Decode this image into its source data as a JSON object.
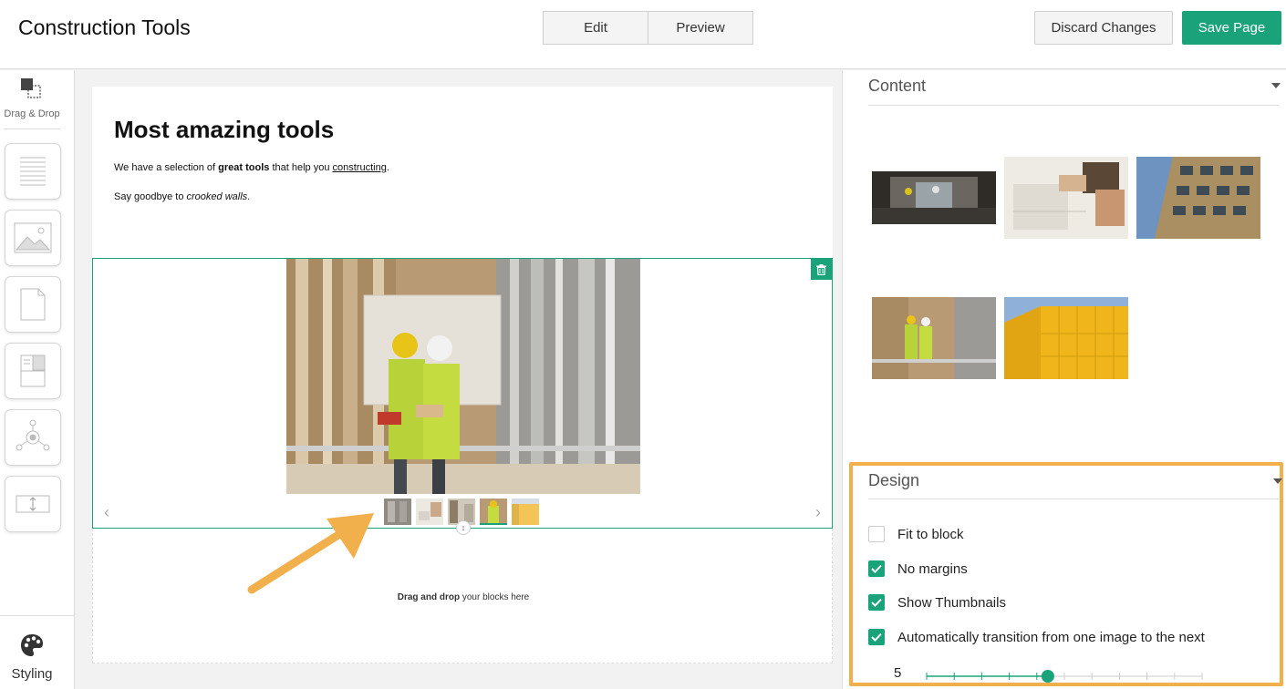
{
  "header": {
    "title": "Construction Tools",
    "mode_tabs": [
      "Edit",
      "Preview"
    ],
    "discard_label": "Discard Changes",
    "save_label": "Save Page"
  },
  "sidebar": {
    "drag_drop_label": "Drag & Drop",
    "blocks": [
      "text-block-icon",
      "image-block-icon",
      "page-block-icon",
      "layout-block-icon",
      "graph-block-icon",
      "spacer-block-icon"
    ],
    "styling_label": "Styling"
  },
  "canvas": {
    "heading": "Most amazing tools",
    "para1_pre": "We have a selection of ",
    "para1_bold": "great tools",
    "para1_mid": " that help you ",
    "para1_link": "constructing",
    "para1_post": ".",
    "para2_pre": "Say goodbye to ",
    "para2_italic": "crooked walls",
    "para2_post": ".",
    "drop_bold": "Drag and drop",
    "drop_rest": " your blocks here",
    "active_thumb_index": 3
  },
  "right_panel": {
    "content_title": "Content",
    "design_title": "Design",
    "options": [
      {
        "label": "Fit to block",
        "checked": false
      },
      {
        "label": "No margins",
        "checked": true
      },
      {
        "label": "Show Thumbnails",
        "checked": true
      },
      {
        "label": "Automatically transition from one image to the next",
        "checked": true
      }
    ],
    "transition_value": "5",
    "slider_fraction": 0.44
  },
  "colors": {
    "accent": "#1aa37a",
    "annotation": "#f2b04d"
  }
}
